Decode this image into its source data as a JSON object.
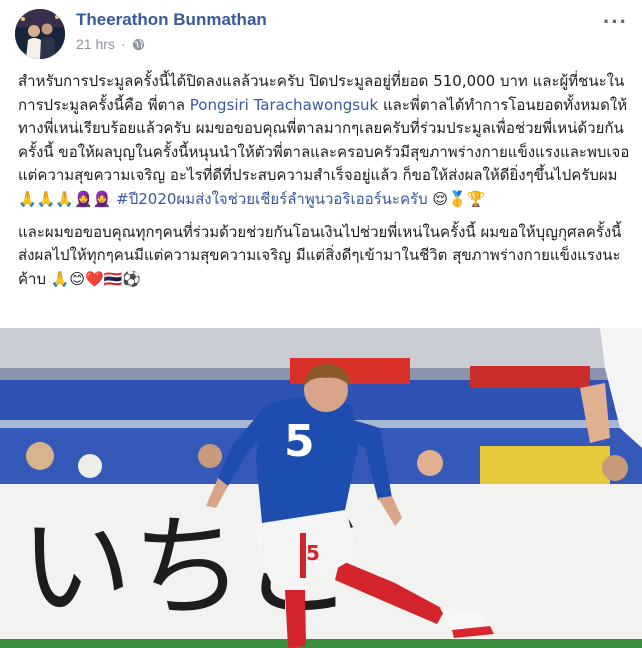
{
  "post": {
    "author": "Theerathon Bunmathan",
    "timestamp": "21 hrs",
    "audience_icon": "globe-icon",
    "more_icon": "more-options-icon",
    "more_label": "···",
    "p1_a": "สำหรับการประมูลครั้งนี้ได้ปิดลงแลล้วนะครับ ปิดประมูลอยู่ที่ยอด 510,000 บาท และผู้ที่ชนะในการประมูลครั้งนี้คือ พี่ตาล ",
    "p1_mention": "Pongsiri Tarachawongsuk",
    "p1_b": " และพี่ตาลได้ทำการโอนยอดทั้งหมดให้ทางพี่เหน่เรียบร้อยแล้วครับ ผมขอขอบคุณพี่ตาลมากๆเลยครับที่ร่วมประมูลเพื่อช่วยพี่เหน่ด้วยกันครั้งนี้ ขอให้ผลบุญในครั้งนี้หนุนนำให้ตัวพี่ตาลและครอบครัวมีสุขภาพร่างกายแข็งแรงและพบเจอแต่ความสุขความเจริญ อะไรที่ดีที่ประสบความสำเร็จอยู่แล้ว ก็ขอให้ส่งผลให้ดียิ่งๆขึ้นไปครับผม 🙏🙏🙏🧕🧕 ",
    "p1_hashtag": "#ปี2020ผมส่งใจช่วยเชียร์ลำพูนวอริเออร์นะครับ",
    "p1_emojis": " 😌🥇🏆",
    "p2": "และผมขอขอบคุณทุกๆคนที่ร่วมด้วยช่วยกันโอนเงินไปช่วยพี่เหน่ในครั้งนี้ ผมขอให้บุญกุศลครั้งนี้ส่งผลไปให้ทุกๆคนมีแต่ความสุขความเจริญ มีแต่สิ่งดีๆเข้ามาในชีวิต สุขภาพร่างกายแข็งแรงนะค้าบ 🙏😊❤️🇹🇭⚽"
  },
  "photo": {
    "banner_text": "いちご",
    "jersey_number": "5",
    "colors": {
      "jersey": "#1e4db0",
      "stands": "#2a4aa8",
      "banner": "#f2f2f0",
      "socks": "#d3242c",
      "pitch": "#3c8f3a"
    }
  },
  "colors": {
    "link": "#385898",
    "text": "#1c1e21",
    "muted": "#90949c"
  }
}
